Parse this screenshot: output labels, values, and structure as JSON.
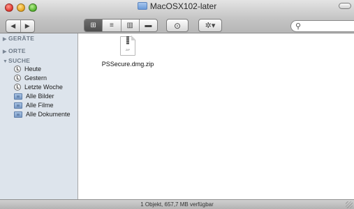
{
  "window": {
    "title": "MacOSX102-later"
  },
  "toolbar": {
    "back_icon": "back-arrow-icon",
    "back_glyph": "◀",
    "forward_glyph": "▶",
    "view_buttons": [
      {
        "name": "icon-view",
        "glyph": "⊞"
      },
      {
        "name": "list-view",
        "glyph": "≡"
      },
      {
        "name": "column-view",
        "glyph": "▥"
      },
      {
        "name": "coverflow-view",
        "glyph": "▬"
      }
    ],
    "quicklook_glyph": "⊙",
    "action_glyph": "✲▾",
    "search_placeholder": "",
    "search_value": ""
  },
  "sidebar": {
    "sections": [
      {
        "label": "GERÄTE",
        "expanded": false
      },
      {
        "label": "ORTE",
        "expanded": false
      },
      {
        "label": "SUCHE",
        "expanded": true
      }
    ],
    "search_items": [
      {
        "label": "Heute",
        "icon": "clock-icon"
      },
      {
        "label": "Gestern",
        "icon": "clock-icon"
      },
      {
        "label": "Letzte Woche",
        "icon": "clock-icon"
      },
      {
        "label": "Alle Bilder",
        "icon": "smart-folder-icon"
      },
      {
        "label": "Alle Filme",
        "icon": "smart-folder-icon"
      },
      {
        "label": "Alle Dokumente",
        "icon": "smart-folder-icon"
      }
    ]
  },
  "files": [
    {
      "name": "PSSecure.dmg.zip",
      "icon": "zip-file-icon",
      "icon_text": "ZIP"
    }
  ],
  "status": {
    "text": "1 Objekt, 657,7 MB verfügbar"
  }
}
